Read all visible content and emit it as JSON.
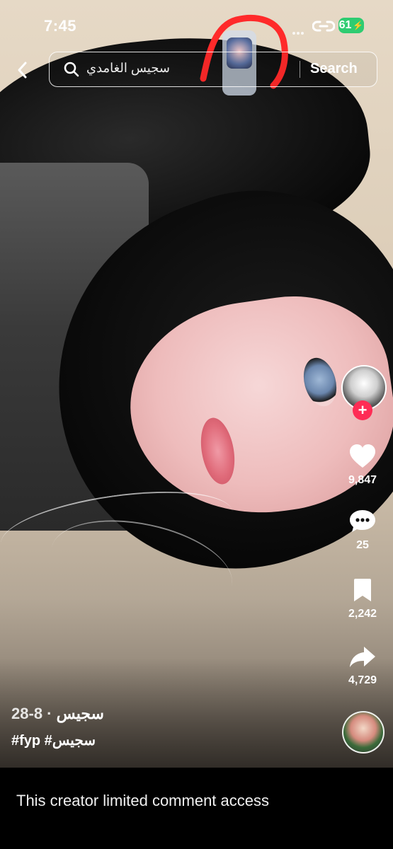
{
  "status_bar": {
    "time": "7:45",
    "battery_level": "61"
  },
  "search_bar": {
    "query": "سجيس الغامدي",
    "search_label": "Search"
  },
  "actions": {
    "likes": "9,847",
    "comments": "25",
    "saves": "2,242",
    "shares": "4,729"
  },
  "caption": {
    "author": "سجيس",
    "date": "· 8-28",
    "hashtags": "#fyp #سجيس"
  },
  "comment_notice": "This creator limited comment access",
  "colors": {
    "follow_badge": "#fe2c55",
    "battery": "#2ecc71",
    "annotation_circle": "#ff2a2a"
  },
  "icons": [
    "back-chevron-icon",
    "search-icon",
    "link-icon",
    "heart-icon",
    "comment-bubble-icon",
    "bookmark-icon",
    "share-arrow-icon"
  ]
}
